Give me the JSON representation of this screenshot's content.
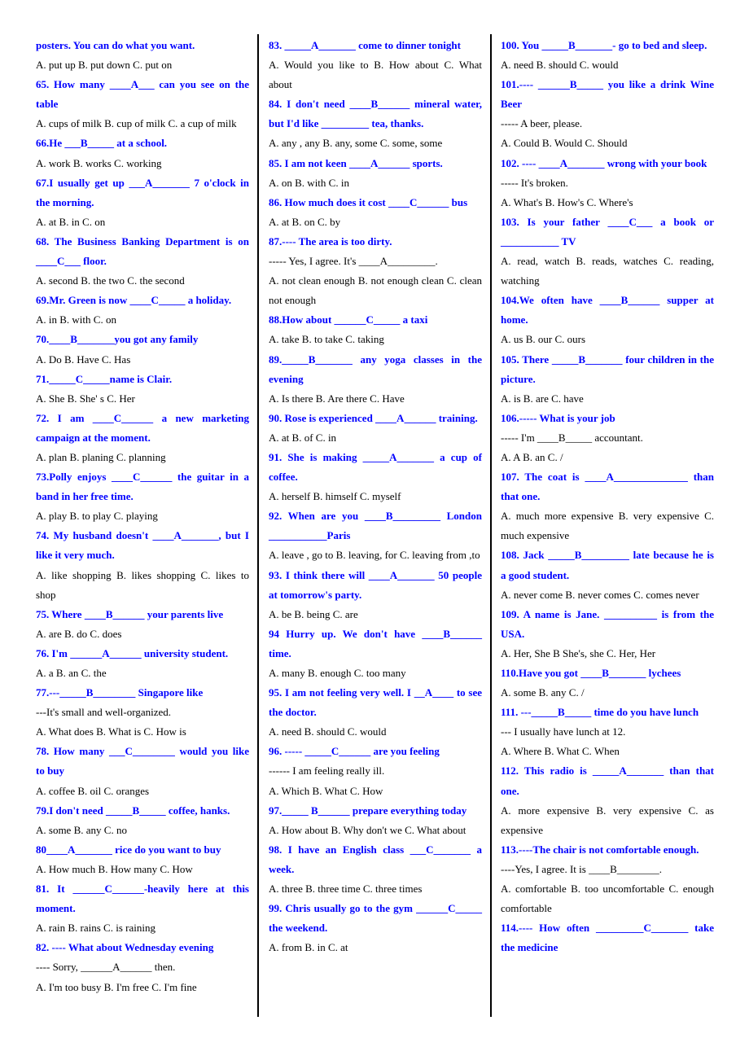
{
  "columns": [
    {
      "lines": [
        {
          "kind": "question",
          "text": "posters. You can do what you want."
        },
        {
          "kind": "option",
          "text": "A. put up B. put down C. put on"
        },
        {
          "kind": "question",
          "text": "65. How many ____A___ can you see on the table"
        },
        {
          "kind": "option",
          "text": "A. cups of milk B. cup of milk C. a cup of milk"
        },
        {
          "kind": "question",
          "text": "66.He ___B_____ at a school."
        },
        {
          "kind": "option",
          "text": "A. work B. works C. working"
        },
        {
          "kind": "question",
          "text": "67.I usually get up ___A_______ 7 o'clock in the morning."
        },
        {
          "kind": "option",
          "text": "A. at B. in C. on"
        },
        {
          "kind": "question",
          "text": "68. The Business Banking Department is on ____C___ floor."
        },
        {
          "kind": "option",
          "text": "A. second B. the two C. the second"
        },
        {
          "kind": "question",
          "text": "69.Mr. Green is now ____C_____ a holiday."
        },
        {
          "kind": "option",
          "text": "A. in B. with C. on"
        },
        {
          "kind": "question",
          "text": "70.____B_______you got any family"
        },
        {
          "kind": "option",
          "text": "A. Do B. Have C. Has"
        },
        {
          "kind": "question",
          "text": "71._____C_____name is Clair."
        },
        {
          "kind": "option",
          "text": "A. She B. She' s C. Her"
        },
        {
          "kind": "question",
          "text": "72. I am ____C______ a new marketing campaign at the moment."
        },
        {
          "kind": "option",
          "text": "A. plan B. planing C. planning"
        },
        {
          "kind": "question",
          "text": "73.Polly enjoys ____C______ the guitar in a band in her free time."
        },
        {
          "kind": "option",
          "text": "A. play B. to play C. playing"
        },
        {
          "kind": "question",
          "text": "74. My husband doesn't ____A_______, but I like it very much."
        },
        {
          "kind": "option",
          "text": "A. like shopping B. likes shopping C. likes to shop"
        },
        {
          "kind": "question",
          "text": "75. Where ____B______ your parents live"
        },
        {
          "kind": "option",
          "text": "A. are B. do C. does"
        },
        {
          "kind": "question",
          "text": "76. I'm ______A______ university student."
        },
        {
          "kind": "option",
          "text": "A. a B. an C. the"
        },
        {
          "kind": "question",
          "text": "77.---_____B________ Singapore like"
        },
        {
          "kind": "option",
          "text": "---It's small and well-organized."
        },
        {
          "kind": "option",
          "text": "A. What does B. What is C. How is"
        },
        {
          "kind": "question",
          "text": "78. How many ___C________ would you like to buy"
        },
        {
          "kind": "option",
          "text": "A. coffee B. oil C. oranges"
        },
        {
          "kind": "question",
          "text": "79.I don't need _____B_____ coffee, hanks."
        },
        {
          "kind": "option",
          "text": "A. some B. any C. no"
        },
        {
          "kind": "question",
          "text": "80____A_______ rice do you want to buy"
        },
        {
          "kind": "option",
          "text": "A. How much B. How many C. How"
        },
        {
          "kind": "question",
          "text": "81. It ______C______-heavily here at this moment."
        },
        {
          "kind": "option",
          "text": "A. rain B. rains C. is raining"
        },
        {
          "kind": "question",
          "text": "82. ---- What about Wednesday evening"
        },
        {
          "kind": "option",
          "text": "---- Sorry, ______A______ then."
        },
        {
          "kind": "option",
          "text": "A. I'm too busy B. I'm free C. I'm fine"
        }
      ]
    },
    {
      "lines": [
        {
          "kind": "question",
          "text": "83. _____A_______ come to dinner tonight"
        },
        {
          "kind": "option",
          "text": "A. Would you like to B. How about C. What about"
        },
        {
          "kind": "question",
          "text": "84. I don't need ____B______ mineral water, but I'd like _________ tea, thanks."
        },
        {
          "kind": "option",
          "text": "A. any , any B. any, some C. some, some"
        },
        {
          "kind": "question",
          "text": "85. I am not keen ____A______ sports."
        },
        {
          "kind": "option",
          "text": "A. on B. with C. in"
        },
        {
          "kind": "question",
          "text": "86. How much does it cost ____C______ bus"
        },
        {
          "kind": "option",
          "text": "A. at B. on C. by"
        },
        {
          "kind": "question",
          "text": "87.---- The area is too dirty."
        },
        {
          "kind": "option",
          "text": "----- Yes, I agree. It's ____A_________."
        },
        {
          "kind": "option",
          "text": "A. not clean enough B. not enough clean C. clean not enough"
        },
        {
          "kind": "question",
          "text": "88.How about ______C_____ a taxi"
        },
        {
          "kind": "option",
          "text": "A. take B. to take C. taking"
        },
        {
          "kind": "question",
          "text": "89._____B_______ any yoga classes in the evening"
        },
        {
          "kind": "option",
          "text": "A. Is there B. Are there C. Have"
        },
        {
          "kind": "question",
          "text": "90. Rose is experienced ____A______ training."
        },
        {
          "kind": "option",
          "text": "A. at B. of C. in"
        },
        {
          "kind": "question",
          "text": "91. She is making _____A_______ a cup of coffee."
        },
        {
          "kind": "option",
          "text": "A. herself B. himself C. myself"
        },
        {
          "kind": "question",
          "text": "92. When are you ____B_________ London ___________Paris"
        },
        {
          "kind": "option",
          "text": "A. leave , go to B. leaving, for C. leaving from ,to"
        },
        {
          "kind": "question",
          "text": "93. I think there will ____A_______ 50 people at tomorrow's party."
        },
        {
          "kind": "option",
          "text": "A. be B. being C. are"
        },
        {
          "kind": "question",
          "text": "94 Hurry up. We don't have ____B______ time."
        },
        {
          "kind": "option",
          "text": "A. many B. enough C. too many"
        },
        {
          "kind": "question",
          "text": "95. I am not feeling very well. I __A____ to see the doctor."
        },
        {
          "kind": "option",
          "text": "A. need B. should C. would"
        },
        {
          "kind": "question",
          "text": "96. ----- _____C______ are you feeling"
        },
        {
          "kind": "option",
          "text": "------ I am feeling really ill."
        },
        {
          "kind": "option",
          "text": "A. Which B. What C. How"
        },
        {
          "kind": "question",
          "text": "97._____ B______ prepare everything today"
        },
        {
          "kind": "option",
          "text": "A. How about B. Why don't we C. What about"
        },
        {
          "kind": "question",
          "text": "98. I have an English class ___C_______ a week."
        },
        {
          "kind": "option",
          "text": "A. three B. three time C. three times"
        },
        {
          "kind": "question",
          "text": "99. Chris usually go to the gym ______C_____ the weekend."
        },
        {
          "kind": "option",
          "text": "A. from B. in C. at"
        }
      ]
    },
    {
      "lines": [
        {
          "kind": "question",
          "text": "100. You _____B_______- go to bed and sleep."
        },
        {
          "kind": "option",
          "text": "A. need B. should C. would"
        },
        {
          "kind": "question",
          "text": "101.---- ______B_____ you like a drink Wine Beer"
        },
        {
          "kind": "option",
          "text": "----- A beer, please."
        },
        {
          "kind": "option",
          "text": "A. Could B. Would C. Should"
        },
        {
          "kind": "question",
          "text": "102. ---- ____A_______ wrong with your book"
        },
        {
          "kind": "option",
          "text": "----- It's broken."
        },
        {
          "kind": "option",
          "text": "A. What's B. How's C. Where's"
        },
        {
          "kind": "question",
          "text": "103. Is your father ____C___ a book or ___________ TV"
        },
        {
          "kind": "option",
          "text": "A. read, watch B. reads, watches C. reading, watching"
        },
        {
          "kind": "question",
          "text": "104.We often have ____B______ supper at home."
        },
        {
          "kind": "option",
          "text": "A. us B. our C. ours"
        },
        {
          "kind": "question",
          "text": "105. There _____B_______ four children in the picture."
        },
        {
          "kind": "option",
          "text": "A. is B. are C. have"
        },
        {
          "kind": "question",
          "text": "106.----- What is your job"
        },
        {
          "kind": "option",
          "text": "----- I'm ____B_____ accountant."
        },
        {
          "kind": "option",
          "text": "A. A B. an C. /"
        },
        {
          "kind": "question",
          "text": "107. The coat is ____A______________ than that one."
        },
        {
          "kind": "option",
          "text": "A. much more expensive B. very expensive C. much expensive"
        },
        {
          "kind": "question",
          "text": "108. Jack _____B_________ late because he is a good student."
        },
        {
          "kind": "option",
          "text": "A. never come B. never comes C. comes never"
        },
        {
          "kind": "question",
          "text": "109. A name is Jane. __________ is from the USA."
        },
        {
          "kind": "option",
          "text": "A. Her, She B She's, she C. Her, Her"
        },
        {
          "kind": "question",
          "text": "110.Have you got ____B_______ lychees"
        },
        {
          "kind": "option",
          "text": "A. some B. any C. /"
        },
        {
          "kind": "question",
          "text": "111. ---_____B_____ time do you have lunch"
        },
        {
          "kind": "option",
          "text": "--- I usually have lunch at 12."
        },
        {
          "kind": "option",
          "text": "A. Where B. What C. When"
        },
        {
          "kind": "question",
          "text": "112. This radio is _____A_______ than that one."
        },
        {
          "kind": "option",
          "text": "A. more expensive B. very expensive C. as expensive"
        },
        {
          "kind": "question",
          "text": "113.----The chair is not comfortable enough."
        },
        {
          "kind": "option",
          "text": "----Yes, I agree. It is ____B________."
        },
        {
          "kind": "option",
          "text": "A. comfortable B. too uncomfortable C. enough comfortable"
        },
        {
          "kind": "question",
          "text": "114.---- How often _________C_______ take the medicine"
        }
      ]
    }
  ]
}
